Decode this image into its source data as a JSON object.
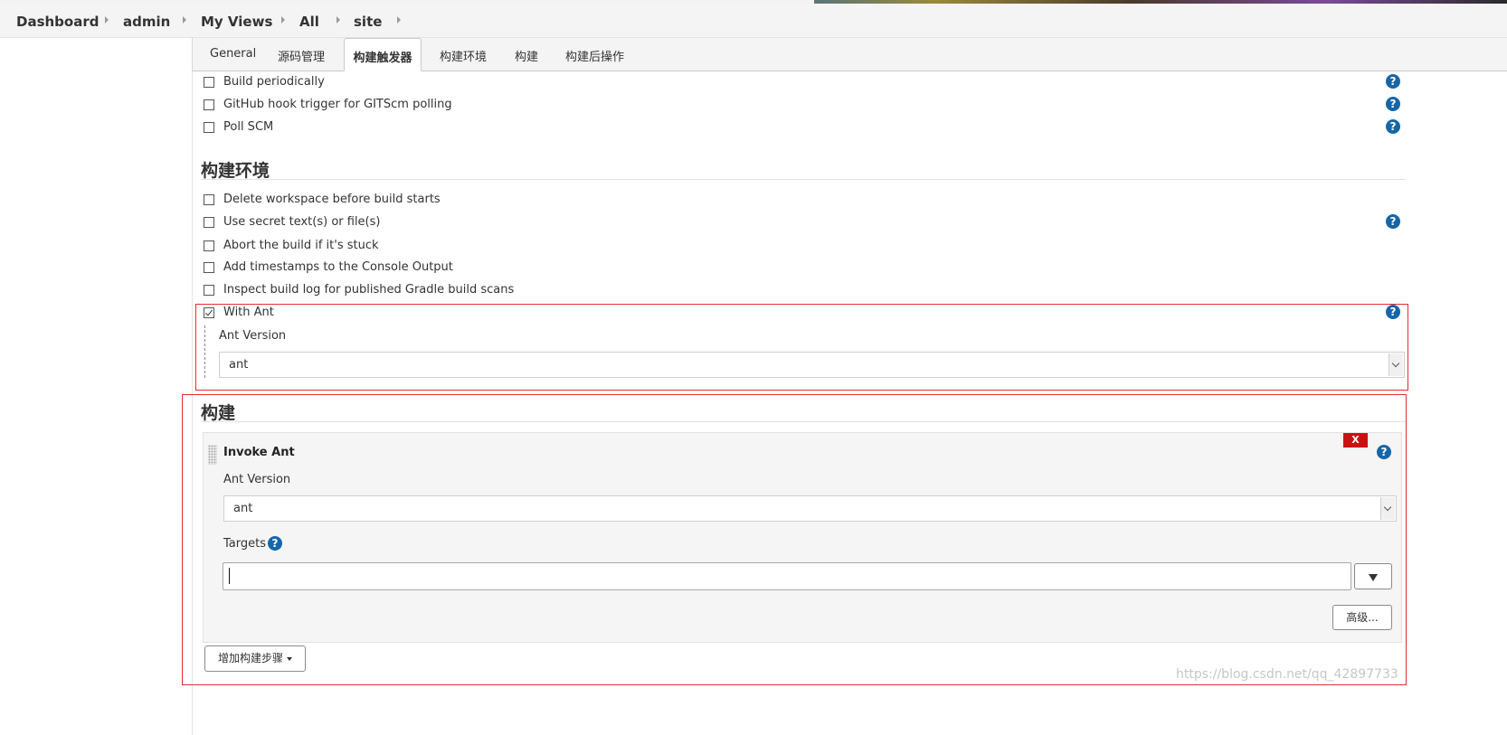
{
  "breadcrumb": [
    {
      "label": "Dashboard"
    },
    {
      "label": "admin"
    },
    {
      "label": "My Views"
    },
    {
      "label": "All"
    },
    {
      "label": "site"
    }
  ],
  "tabs": [
    {
      "label": "General"
    },
    {
      "label": "源码管理"
    },
    {
      "label": "构建触发器",
      "active": true
    },
    {
      "label": "构建环境"
    },
    {
      "label": "构建"
    },
    {
      "label": "构建后操作"
    }
  ],
  "triggers": [
    {
      "label": "Build periodically",
      "checked": false
    },
    {
      "label": "GitHub hook trigger for GITScm polling",
      "checked": false
    },
    {
      "label": "Poll SCM",
      "checked": false
    }
  ],
  "build_env": {
    "title": "构建环境",
    "options": [
      {
        "label": "Delete workspace before build starts",
        "checked": false
      },
      {
        "label": "Use secret text(s) or file(s)",
        "checked": false
      },
      {
        "label": "Abort the build if it's stuck",
        "checked": false
      },
      {
        "label": "Add timestamps to the Console Output",
        "checked": false
      },
      {
        "label": "Inspect build log for published Gradle build scans",
        "checked": false
      },
      {
        "label": "With Ant",
        "checked": true
      }
    ],
    "ant_version_label": "Ant Version",
    "ant_version_value": "ant"
  },
  "build": {
    "title": "构建",
    "step_title": "Invoke Ant",
    "delete_label": "X",
    "ant_version_label": "Ant Version",
    "ant_version_value": "ant",
    "targets_label": "Targets",
    "targets_value": "",
    "advanced_label": "高级...",
    "add_step_label": "增加构建步骤"
  },
  "help_glyph": "?",
  "watermark": "https://blog.csdn.net/qq_42897733",
  "colors": {
    "help": "#1566a8",
    "delete": "#cc1111",
    "highlight_box": "#e52d2d"
  }
}
